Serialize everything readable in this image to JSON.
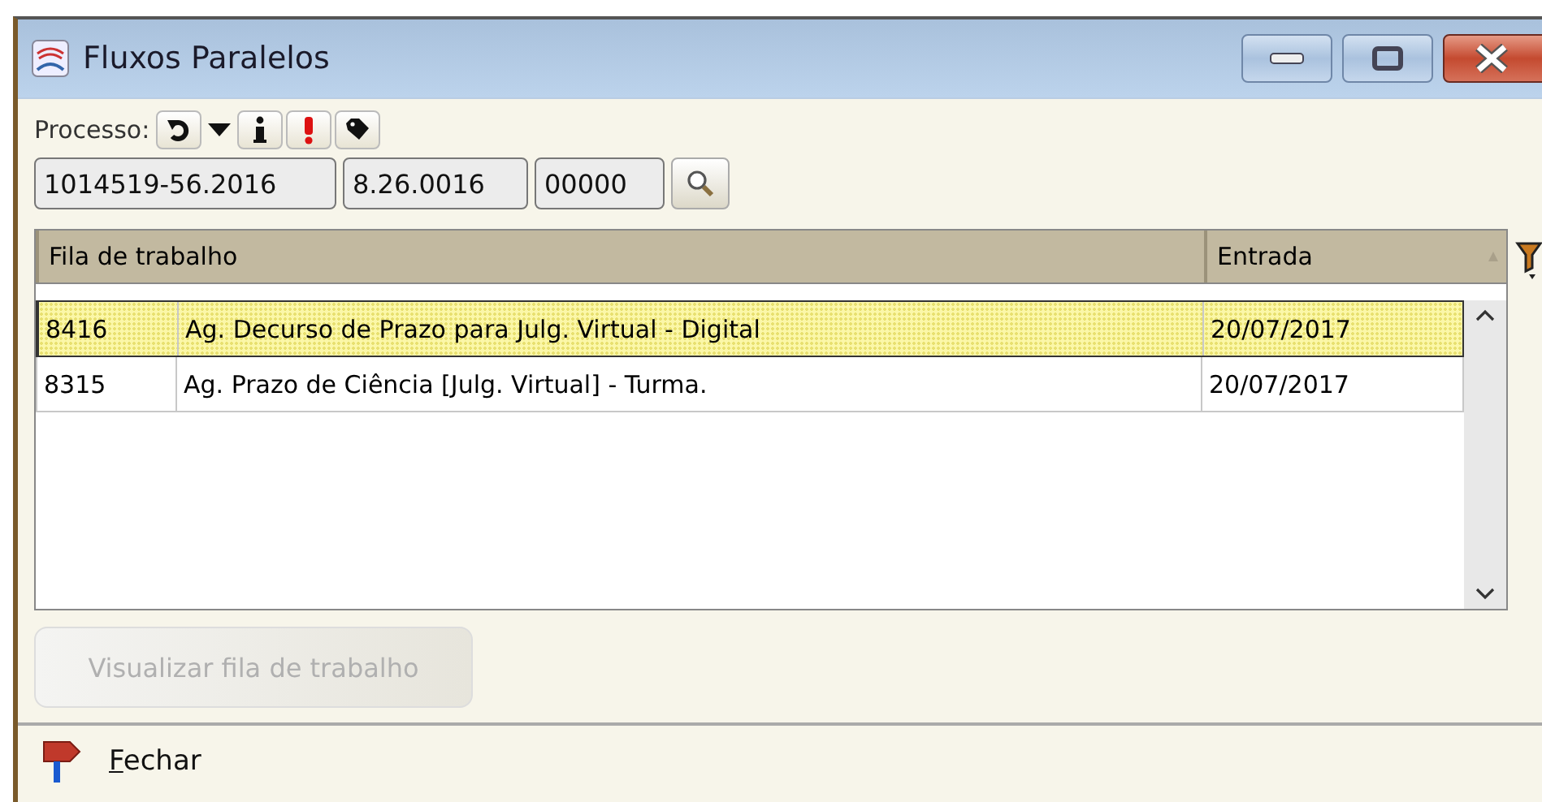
{
  "window": {
    "title": "Fluxos Paralelos"
  },
  "processo": {
    "label": "Processo:",
    "fields": [
      {
        "value": "1014519-56.2016"
      },
      {
        "value": "8.26.0016"
      },
      {
        "value": "00000"
      }
    ]
  },
  "table": {
    "columns": [
      "Fila de trabalho",
      "Entrada"
    ],
    "rows": [
      {
        "code": "8416",
        "name": "Ag. Decurso de Prazo para Julg. Virtual - Digital",
        "date": "20/07/2017",
        "selected": true
      },
      {
        "code": "8315",
        "name": "Ag. Prazo de Ciência [Julg. Virtual] - Turma.",
        "date": "20/07/2017",
        "selected": false
      }
    ]
  },
  "view_button": {
    "label": "Visualizar fila de trabalho",
    "disabled": true
  },
  "close_button": {
    "label": "Fechar"
  }
}
